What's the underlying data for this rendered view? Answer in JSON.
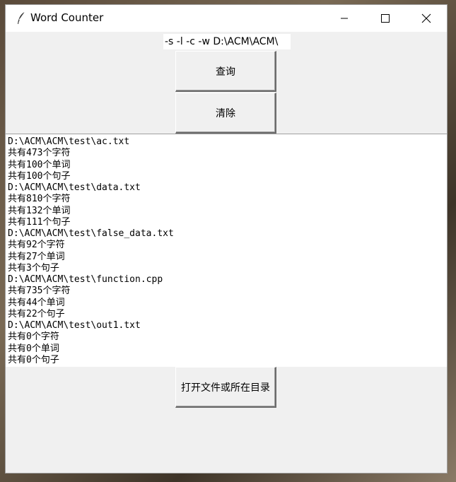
{
  "window": {
    "title": "Word Counter",
    "controls": {
      "minimize_icon": "minimize-icon",
      "maximize_icon": "maximize-icon",
      "close_icon": "close-icon"
    }
  },
  "command_input": {
    "value": "-s -l -c -w D:\\ACM\\ACM\\"
  },
  "buttons": {
    "query_label": "查询",
    "clear_label": "清除",
    "open_label": "打开文件或所在目录"
  },
  "output_lines": [
    "D:\\ACM\\ACM\\test\\ac.txt",
    "共有473个字符",
    "共有100个单词",
    "共有100个句子",
    "D:\\ACM\\ACM\\test\\data.txt",
    "共有810个字符",
    "共有132个单词",
    "共有111个句子",
    "D:\\ACM\\ACM\\test\\false_data.txt",
    "共有92个字符",
    "共有27个单词",
    "共有3个句子",
    "D:\\ACM\\ACM\\test\\function.cpp",
    "共有735个字符",
    "共有44个单词",
    "共有22个句子",
    "D:\\ACM\\ACM\\test\\out1.txt",
    "共有0个字符",
    "共有0个单词",
    "共有0个句子"
  ]
}
